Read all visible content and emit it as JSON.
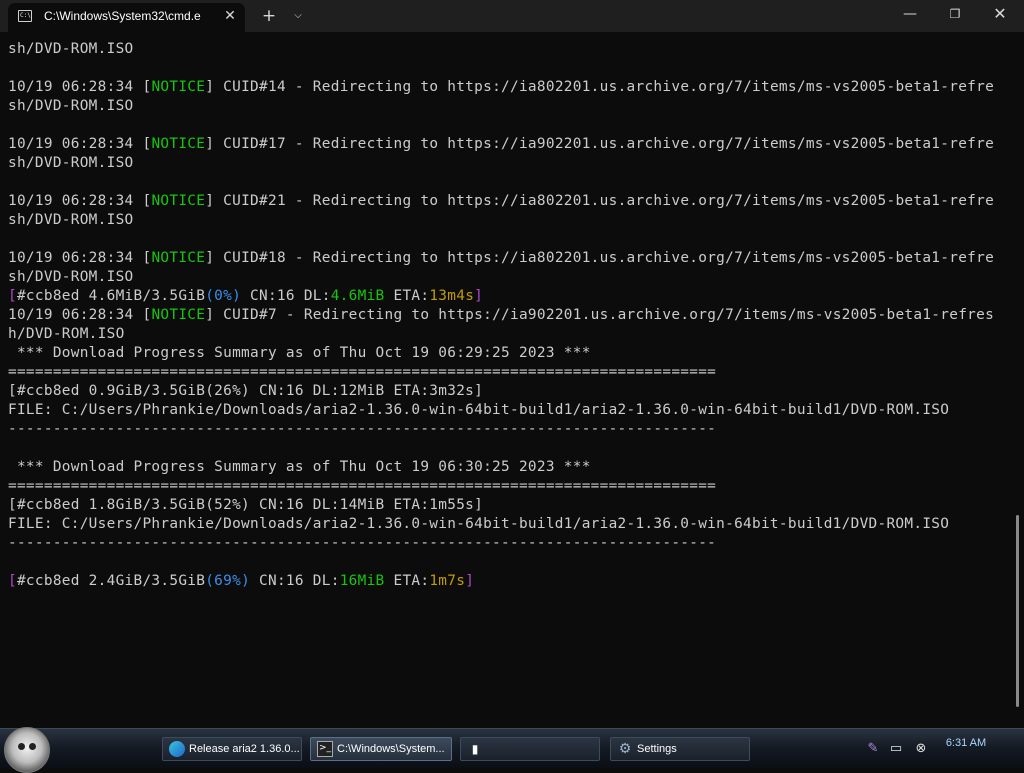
{
  "window": {
    "tab_title": "C:\\Windows\\System32\\cmd.e",
    "tab_icon_glyph": "C:\\",
    "close_glyph": "✕",
    "new_tab_glyph": "+",
    "dropdown_glyph": "⌵",
    "minimize_glyph": "—",
    "maximize_glyph": "❐",
    "window_close_glyph": "✕"
  },
  "terminal": {
    "colors": {
      "background": "#0c0c0c",
      "text": "#cccccc",
      "notice": "#16c60c",
      "bracket": "#b148c6",
      "percent": "#3b8eea",
      "eta": "#c19c00"
    },
    "lines": [
      [
        {
          "t": "sh/DVD-ROM.ISO"
        }
      ],
      [],
      [
        {
          "t": "10/19 06:28:34 ["
        },
        {
          "t": "NOTICE",
          "c": "green"
        },
        {
          "t": "] CUID#14 - Redirecting to https://ia802201.us.archive.org/7/items/ms-vs2005-beta1-refre"
        }
      ],
      [
        {
          "t": "sh/DVD-ROM.ISO"
        }
      ],
      [],
      [
        {
          "t": "10/19 06:28:34 ["
        },
        {
          "t": "NOTICE",
          "c": "green"
        },
        {
          "t": "] CUID#17 - Redirecting to https://ia902201.us.archive.org/7/items/ms-vs2005-beta1-refre"
        }
      ],
      [
        {
          "t": "sh/DVD-ROM.ISO"
        }
      ],
      [],
      [
        {
          "t": "10/19 06:28:34 ["
        },
        {
          "t": "NOTICE",
          "c": "green"
        },
        {
          "t": "] CUID#21 - Redirecting to https://ia802201.us.archive.org/7/items/ms-vs2005-beta1-refre"
        }
      ],
      [
        {
          "t": "sh/DVD-ROM.ISO"
        }
      ],
      [],
      [
        {
          "t": "10/19 06:28:34 ["
        },
        {
          "t": "NOTICE",
          "c": "green"
        },
        {
          "t": "] CUID#18 - Redirecting to https://ia802201.us.archive.org/7/items/ms-vs2005-beta1-refre"
        }
      ],
      [
        {
          "t": "sh/DVD-ROM.ISO"
        }
      ],
      [
        {
          "t": "[",
          "c": "magenta"
        },
        {
          "t": "#ccb8ed 4.6MiB/3.5GiB"
        },
        {
          "t": "(0%)",
          "c": "blue"
        },
        {
          "t": " CN:16 DL:"
        },
        {
          "t": "4.6MiB",
          "c": "green"
        },
        {
          "t": " ETA:"
        },
        {
          "t": "13m4s",
          "c": "yellow"
        },
        {
          "t": "]",
          "c": "magenta"
        }
      ],
      [
        {
          "t": "10/19 06:28:34 ["
        },
        {
          "t": "NOTICE",
          "c": "green"
        },
        {
          "t": "] CUID#7 - Redirecting to https://ia902201.us.archive.org/7/items/ms-vs2005-beta1-refres"
        }
      ],
      [
        {
          "t": "h/DVD-ROM.ISO"
        }
      ],
      [
        {
          "t": " *** Download Progress Summary as of Thu Oct 19 06:29:25 2023 ***"
        }
      ],
      [
        {
          "t": "==============================================================================="
        }
      ],
      [
        {
          "t": "[#ccb8ed 0.9GiB/3.5GiB(26%) CN:16 DL:12MiB ETA:3m32s]"
        }
      ],
      [
        {
          "t": "FILE: C:/Users/Phrankie/Downloads/aria2-1.36.0-win-64bit-build1/aria2-1.36.0-win-64bit-build1/DVD-ROM.ISO"
        }
      ],
      [
        {
          "t": "-------------------------------------------------------------------------------"
        }
      ],
      [],
      [
        {
          "t": " *** Download Progress Summary as of Thu Oct 19 06:30:25 2023 ***"
        }
      ],
      [
        {
          "t": "==============================================================================="
        }
      ],
      [
        {
          "t": "[#ccb8ed 1.8GiB/3.5GiB(52%) CN:16 DL:14MiB ETA:1m55s]"
        }
      ],
      [
        {
          "t": "FILE: C:/Users/Phrankie/Downloads/aria2-1.36.0-win-64bit-build1/aria2-1.36.0-win-64bit-build1/DVD-ROM.ISO"
        }
      ],
      [
        {
          "t": "-------------------------------------------------------------------------------"
        }
      ],
      [],
      [
        {
          "t": "[",
          "c": "magenta"
        },
        {
          "t": "#ccb8ed 2.4GiB/3.5GiB"
        },
        {
          "t": "(69%)",
          "c": "blue"
        },
        {
          "t": " CN:16 DL:"
        },
        {
          "t": "16MiB",
          "c": "green"
        },
        {
          "t": " ETA:"
        },
        {
          "t": "1m7s",
          "c": "yellow"
        },
        {
          "t": "]",
          "c": "magenta"
        }
      ]
    ]
  },
  "taskbar": {
    "items": [
      {
        "label": "Release aria2 1.36.0...",
        "icon": "edge-icon"
      },
      {
        "label": "C:\\Windows\\System...",
        "icon": "terminal-icon"
      },
      {
        "label": "",
        "icon": "app-icon"
      },
      {
        "label": "Settings",
        "icon": "gear-icon"
      }
    ],
    "tray_icons": [
      "feather-icon",
      "monitor-icon",
      "network-icon"
    ],
    "clock": "6:31 AM"
  }
}
